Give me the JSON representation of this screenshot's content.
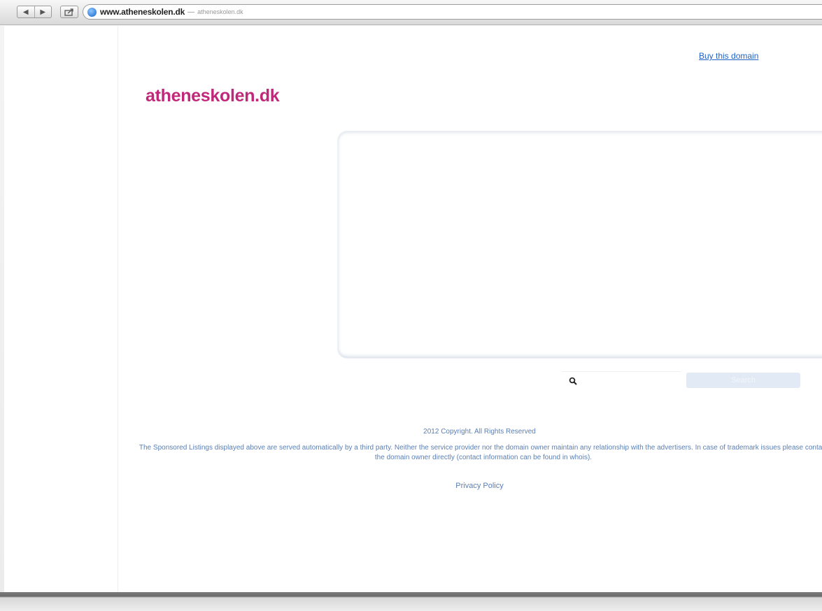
{
  "browser": {
    "back_label": "◀",
    "forward_label": "▶",
    "url_host": "www.atheneskolen.dk",
    "url_separator": "—",
    "page_title": "atheneskolen.dk"
  },
  "page": {
    "buy_link": "Buy this domain",
    "logo": "atheneskolen.dk",
    "search": {
      "placeholder": "",
      "button_label": "Search"
    },
    "copyright": "2012 Copyright. All Rights Reserved",
    "disclaimer": "The Sponsored Listings displayed above are served automatically by a third party. Neither the service provider nor the domain owner maintain any relationship with the advertisers. In case of trademark issues please contact the domain owner directly (contact information can be found in whois).",
    "privacy_link": "Privacy Policy"
  },
  "colors": {
    "logo": "#c0297a",
    "link": "#1e62c6",
    "footer_text": "#5a7fb5"
  },
  "icons": [
    "back-icon",
    "forward-icon",
    "share-icon",
    "globe-icon",
    "search-icon"
  ]
}
